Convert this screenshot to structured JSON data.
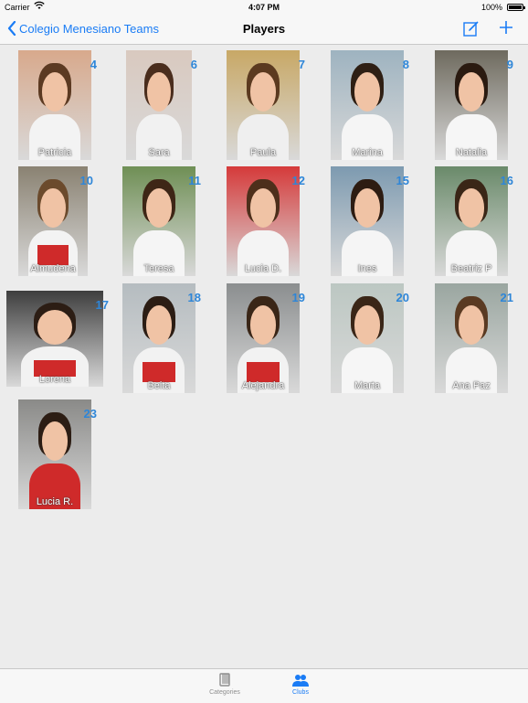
{
  "status_bar": {
    "carrier": "Carrier",
    "time": "4:07 PM",
    "battery": "100%"
  },
  "nav": {
    "back_label": "Colegio Menesiano Teams",
    "title": "Players"
  },
  "players": [
    {
      "name": "Patricia",
      "number": "4",
      "colors": [
        "#d8a98c",
        "#5c3a22",
        "#f3f3f3",
        "#f3f3f3"
      ]
    },
    {
      "name": "Sara",
      "number": "6",
      "colors": [
        "#d9c9bf",
        "#4a2d1d",
        "#f1f1f1",
        "#f1f1f1"
      ]
    },
    {
      "name": "Paula",
      "number": "7",
      "colors": [
        "#c8a866",
        "#5b3a20",
        "#efefef",
        "#efefef"
      ]
    },
    {
      "name": "Marina",
      "number": "8",
      "colors": [
        "#9eb3c0",
        "#2e1f14",
        "#f5f5f5",
        "#f5f5f5"
      ]
    },
    {
      "name": "Natalia",
      "number": "9",
      "colors": [
        "#6e6a5e",
        "#2a1a10",
        "#f6f6f6",
        "#f6f6f6"
      ]
    },
    {
      "name": "Almudena",
      "number": "10",
      "colors": [
        "#8a8272",
        "#6b4a2c",
        "#f3f3f3",
        "#cf2a2a"
      ]
    },
    {
      "name": "Teresa",
      "number": "11",
      "colors": [
        "#6f8f55",
        "#3e2616",
        "#f5f5f5",
        "#f5f5f5"
      ]
    },
    {
      "name": "Lucia D.",
      "number": "12",
      "colors": [
        "#d53a3a",
        "#4d2f1b",
        "#f4f4f4",
        "#f4f4f4"
      ]
    },
    {
      "name": "Ines",
      "number": "15",
      "colors": [
        "#7d9ab0",
        "#2d1c12",
        "#f5f5f5",
        "#f5f5f5"
      ]
    },
    {
      "name": "Beatriz P",
      "number": "16",
      "colors": [
        "#6a8a6a",
        "#3a2617",
        "#f5f5f5",
        "#f5f5f5"
      ]
    },
    {
      "name": "Lorena",
      "number": "17",
      "colors": [
        "#3e3e3e",
        "#2c1d14",
        "#f2f2f2",
        "#cf2a2a"
      ]
    },
    {
      "name": "Beita",
      "number": "18",
      "colors": [
        "#b5bcc0",
        "#2c1d14",
        "#f2f2f2",
        "#cf2a2a"
      ]
    },
    {
      "name": "Alejandra",
      "number": "19",
      "colors": [
        "#8b8e8f",
        "#3a2617",
        "#f2f2f2",
        "#cf2a2a"
      ]
    },
    {
      "name": "Marta",
      "number": "20",
      "colors": [
        "#bcc7c2",
        "#3a2617",
        "#f6f6f6",
        "#f6f6f6"
      ]
    },
    {
      "name": "Ana Paz",
      "number": "21",
      "colors": [
        "#9aa6a0",
        "#5a3a22",
        "#f5f5f5",
        "#f5f5f5"
      ]
    },
    {
      "name": "Lucia R.",
      "number": "23",
      "colors": [
        "#8a8a88",
        "#2c1d14",
        "#cf2a2a",
        "#cf2a2a"
      ]
    }
  ],
  "tabs": [
    {
      "label": "Categories",
      "icon": "book-icon",
      "active": false
    },
    {
      "label": "Clubs",
      "icon": "people-icon",
      "active": true
    }
  ],
  "colors": {
    "accent": "#1a7cf5",
    "number": "#2e86d8",
    "background": "#ececec"
  }
}
